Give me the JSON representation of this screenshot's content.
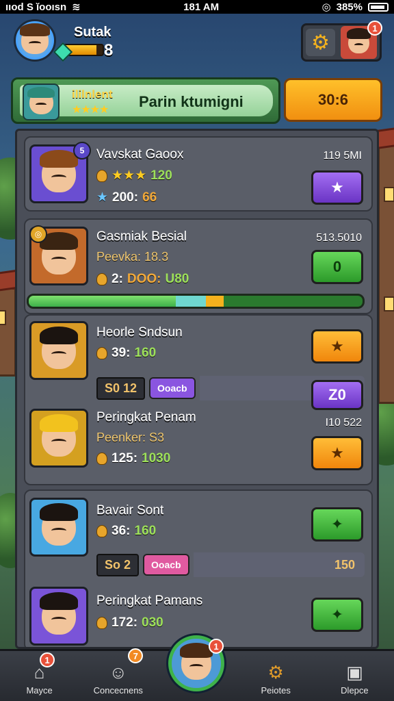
{
  "status_bar": {
    "carrier": "ııod S ĭooısn",
    "time": "181 AM",
    "battery": "385%"
  },
  "player": {
    "name": "Sutak",
    "level": "8",
    "level_progress": 0.85
  },
  "header": {
    "settings_icon": "gear-icon",
    "friend_badge": "1"
  },
  "event": {
    "tag": "ililnlent",
    "stars": "★★★★",
    "title": "Parin ktumigni",
    "button_label": "30:6"
  },
  "entries": [
    {
      "name": "Vavskat Gaoox",
      "score": "119 5MI",
      "stars": "★★★",
      "stars_value": "120",
      "stat_a": "200:",
      "stat_b": "66",
      "button_icon": "star-icon",
      "button_label": "★",
      "avatar_color": "#6a4ed1"
    },
    {
      "name": "Gasmiak Besial",
      "sub": "Peevka: 18.3",
      "score": "513.5010",
      "stat_a": "2:",
      "stat_b": "DOO:",
      "stat_c": "U80",
      "button_label": "0",
      "avatar_color": "#c36a2b"
    },
    {
      "name": "Heorle Sndsun",
      "stat_a": "39:",
      "stat_b": "160",
      "button_label": "★",
      "avatar_color": "#d99b26"
    },
    {
      "name": "Peringkat Penam",
      "sub": "Peenker: S3",
      "score": "I10 522",
      "stat_a": "125:",
      "stat_b": "1030",
      "button_label": "★",
      "avatar_color": "#d4a020"
    },
    {
      "name": "Bavair Sont",
      "stat_a": "36:",
      "stat_b": "160",
      "button_label": "✦",
      "avatar_color": "#48a8e2"
    },
    {
      "name": "Peringkat Pamans",
      "stat_a": "172:",
      "stat_b": "030",
      "button_label": "✦",
      "avatar_color": "#7a54d8"
    }
  ],
  "progress": {
    "green_fraction": 0.44,
    "cyan_fraction": 0.09,
    "label": ""
  },
  "rank_rows": [
    {
      "box": "S0 12",
      "tag": "Ooacb",
      "tag_color": "#8a55e0",
      "button": "Z0"
    },
    {
      "box": "So 2",
      "tag": "Ooacb",
      "tag_color": "#e05aa0",
      "value": "150"
    }
  ],
  "nav": {
    "items": [
      {
        "label": "Mayce",
        "icon": "home-icon",
        "badge": "1"
      },
      {
        "label": "Concecnens",
        "icon": "avatar-icon",
        "badge": "7"
      },
      {
        "label": "",
        "icon": "profile-icon",
        "badge": "1"
      },
      {
        "label": "Peiotes",
        "icon": "gear-icon"
      },
      {
        "label": "Dlepce",
        "icon": "box-icon"
      }
    ]
  }
}
